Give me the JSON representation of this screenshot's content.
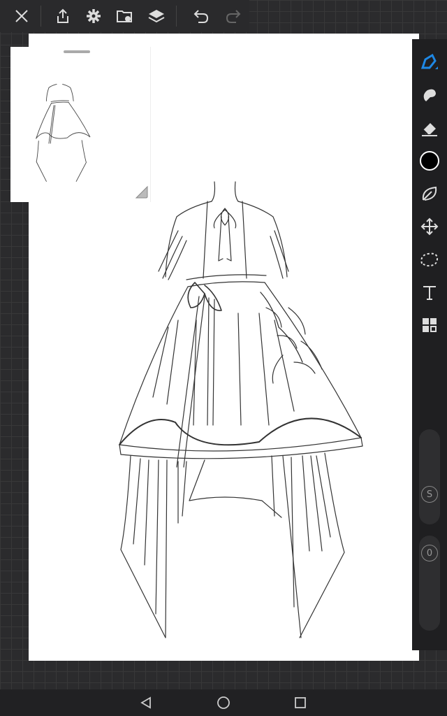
{
  "app": {
    "accent_color": "#1e88e5"
  },
  "topbar": {
    "items": [
      {
        "name": "close-icon"
      },
      {
        "name": "share-icon"
      },
      {
        "name": "gear-icon"
      },
      {
        "name": "gallery-icon"
      },
      {
        "name": "layers-icon"
      },
      {
        "name": "undo-icon"
      },
      {
        "name": "redo-icon"
      }
    ]
  },
  "reference_window": {
    "visible": true
  },
  "tools": {
    "active": "brush",
    "items": [
      {
        "name": "brush-icon",
        "active": true
      },
      {
        "name": "smudge-icon"
      },
      {
        "name": "eraser-icon"
      },
      {
        "name": "color-swatch",
        "color": "#000000"
      },
      {
        "name": "lasso-fill-icon"
      },
      {
        "name": "transform-icon"
      },
      {
        "name": "selection-icon"
      },
      {
        "name": "text-icon"
      },
      {
        "name": "adjustments-icon"
      }
    ],
    "size_label": "S",
    "opacity_label": "0"
  },
  "navbar": {
    "items": [
      {
        "name": "back-icon"
      },
      {
        "name": "home-icon"
      },
      {
        "name": "recents-icon"
      }
    ]
  }
}
